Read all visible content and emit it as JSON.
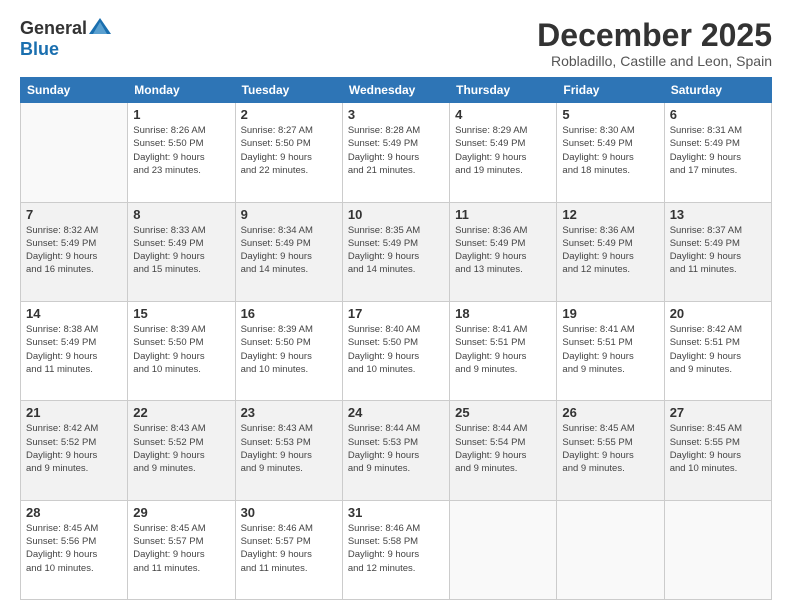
{
  "logo": {
    "general": "General",
    "blue": "Blue"
  },
  "title": "December 2025",
  "subtitle": "Robladillo, Castille and Leon, Spain",
  "weekdays": [
    "Sunday",
    "Monday",
    "Tuesday",
    "Wednesday",
    "Thursday",
    "Friday",
    "Saturday"
  ],
  "weeks": [
    {
      "shaded": false,
      "days": [
        {
          "date": "",
          "info": ""
        },
        {
          "date": "1",
          "info": "Sunrise: 8:26 AM\nSunset: 5:50 PM\nDaylight: 9 hours\nand 23 minutes."
        },
        {
          "date": "2",
          "info": "Sunrise: 8:27 AM\nSunset: 5:50 PM\nDaylight: 9 hours\nand 22 minutes."
        },
        {
          "date": "3",
          "info": "Sunrise: 8:28 AM\nSunset: 5:49 PM\nDaylight: 9 hours\nand 21 minutes."
        },
        {
          "date": "4",
          "info": "Sunrise: 8:29 AM\nSunset: 5:49 PM\nDaylight: 9 hours\nand 19 minutes."
        },
        {
          "date": "5",
          "info": "Sunrise: 8:30 AM\nSunset: 5:49 PM\nDaylight: 9 hours\nand 18 minutes."
        },
        {
          "date": "6",
          "info": "Sunrise: 8:31 AM\nSunset: 5:49 PM\nDaylight: 9 hours\nand 17 minutes."
        }
      ]
    },
    {
      "shaded": true,
      "days": [
        {
          "date": "7",
          "info": "Sunrise: 8:32 AM\nSunset: 5:49 PM\nDaylight: 9 hours\nand 16 minutes."
        },
        {
          "date": "8",
          "info": "Sunrise: 8:33 AM\nSunset: 5:49 PM\nDaylight: 9 hours\nand 15 minutes."
        },
        {
          "date": "9",
          "info": "Sunrise: 8:34 AM\nSunset: 5:49 PM\nDaylight: 9 hours\nand 14 minutes."
        },
        {
          "date": "10",
          "info": "Sunrise: 8:35 AM\nSunset: 5:49 PM\nDaylight: 9 hours\nand 14 minutes."
        },
        {
          "date": "11",
          "info": "Sunrise: 8:36 AM\nSunset: 5:49 PM\nDaylight: 9 hours\nand 13 minutes."
        },
        {
          "date": "12",
          "info": "Sunrise: 8:36 AM\nSunset: 5:49 PM\nDaylight: 9 hours\nand 12 minutes."
        },
        {
          "date": "13",
          "info": "Sunrise: 8:37 AM\nSunset: 5:49 PM\nDaylight: 9 hours\nand 11 minutes."
        }
      ]
    },
    {
      "shaded": false,
      "days": [
        {
          "date": "14",
          "info": "Sunrise: 8:38 AM\nSunset: 5:49 PM\nDaylight: 9 hours\nand 11 minutes."
        },
        {
          "date": "15",
          "info": "Sunrise: 8:39 AM\nSunset: 5:50 PM\nDaylight: 9 hours\nand 10 minutes."
        },
        {
          "date": "16",
          "info": "Sunrise: 8:39 AM\nSunset: 5:50 PM\nDaylight: 9 hours\nand 10 minutes."
        },
        {
          "date": "17",
          "info": "Sunrise: 8:40 AM\nSunset: 5:50 PM\nDaylight: 9 hours\nand 10 minutes."
        },
        {
          "date": "18",
          "info": "Sunrise: 8:41 AM\nSunset: 5:51 PM\nDaylight: 9 hours\nand 9 minutes."
        },
        {
          "date": "19",
          "info": "Sunrise: 8:41 AM\nSunset: 5:51 PM\nDaylight: 9 hours\nand 9 minutes."
        },
        {
          "date": "20",
          "info": "Sunrise: 8:42 AM\nSunset: 5:51 PM\nDaylight: 9 hours\nand 9 minutes."
        }
      ]
    },
    {
      "shaded": true,
      "days": [
        {
          "date": "21",
          "info": "Sunrise: 8:42 AM\nSunset: 5:52 PM\nDaylight: 9 hours\nand 9 minutes."
        },
        {
          "date": "22",
          "info": "Sunrise: 8:43 AM\nSunset: 5:52 PM\nDaylight: 9 hours\nand 9 minutes."
        },
        {
          "date": "23",
          "info": "Sunrise: 8:43 AM\nSunset: 5:53 PM\nDaylight: 9 hours\nand 9 minutes."
        },
        {
          "date": "24",
          "info": "Sunrise: 8:44 AM\nSunset: 5:53 PM\nDaylight: 9 hours\nand 9 minutes."
        },
        {
          "date": "25",
          "info": "Sunrise: 8:44 AM\nSunset: 5:54 PM\nDaylight: 9 hours\nand 9 minutes."
        },
        {
          "date": "26",
          "info": "Sunrise: 8:45 AM\nSunset: 5:55 PM\nDaylight: 9 hours\nand 9 minutes."
        },
        {
          "date": "27",
          "info": "Sunrise: 8:45 AM\nSunset: 5:55 PM\nDaylight: 9 hours\nand 10 minutes."
        }
      ]
    },
    {
      "shaded": false,
      "days": [
        {
          "date": "28",
          "info": "Sunrise: 8:45 AM\nSunset: 5:56 PM\nDaylight: 9 hours\nand 10 minutes."
        },
        {
          "date": "29",
          "info": "Sunrise: 8:45 AM\nSunset: 5:57 PM\nDaylight: 9 hours\nand 11 minutes."
        },
        {
          "date": "30",
          "info": "Sunrise: 8:46 AM\nSunset: 5:57 PM\nDaylight: 9 hours\nand 11 minutes."
        },
        {
          "date": "31",
          "info": "Sunrise: 8:46 AM\nSunset: 5:58 PM\nDaylight: 9 hours\nand 12 minutes."
        },
        {
          "date": "",
          "info": ""
        },
        {
          "date": "",
          "info": ""
        },
        {
          "date": "",
          "info": ""
        }
      ]
    }
  ]
}
